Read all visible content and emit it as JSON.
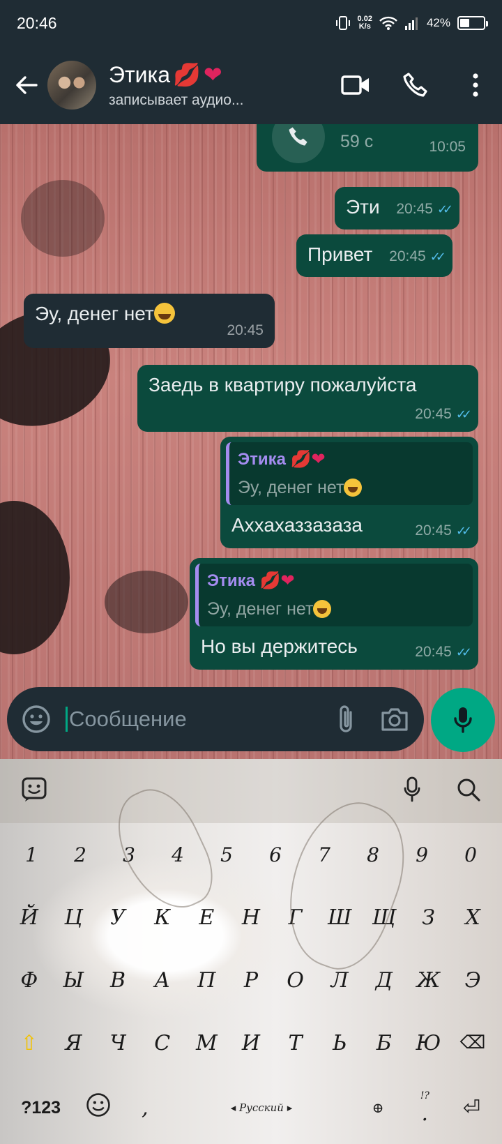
{
  "status_bar": {
    "time": "20:46",
    "net_speed_value": "0.02",
    "net_speed_unit": "K/s",
    "battery": "42%",
    "battery_level": 0.42
  },
  "header": {
    "contact_name": "Этика",
    "contact_status": "записывает аудио...",
    "icons": [
      "back-arrow-icon",
      "video-call-icon",
      "voice-call-icon",
      "more-icon"
    ]
  },
  "messages": [
    {
      "direction": "out",
      "type": "call",
      "duration": "59 с",
      "time": "10:05"
    },
    {
      "direction": "out",
      "text": "Эти",
      "time": "20:45",
      "status": "read"
    },
    {
      "direction": "out",
      "text": "Привет",
      "time": "20:45",
      "status": "read"
    },
    {
      "direction": "in",
      "text": "Эу, денег нет",
      "time": "20:45"
    },
    {
      "direction": "out",
      "text": "Заедь в квартиру пожалуйста",
      "time": "20:45",
      "status": "read"
    },
    {
      "direction": "out",
      "quote_name": "Этика",
      "quote_text": "Эу, денег нет",
      "text": "Аххахаззазаза",
      "time": "20:45",
      "status": "read"
    },
    {
      "direction": "out",
      "quote_name": "Этика",
      "quote_text": "Эу, денег нет",
      "text": "Но вы держитесь",
      "time": "20:45",
      "status": "read"
    }
  ],
  "composer": {
    "placeholder": "Сообщение"
  },
  "keyboard": {
    "row_numbers": [
      "1",
      "2",
      "3",
      "4",
      "5",
      "6",
      "7",
      "8",
      "9",
      "0"
    ],
    "row1": [
      "Й",
      "Ц",
      "У",
      "К",
      "Е",
      "Н",
      "Г",
      "Ш",
      "Щ",
      "З",
      "Х"
    ],
    "row2": [
      "Ф",
      "Ы",
      "В",
      "А",
      "П",
      "Р",
      "О",
      "Л",
      "Д",
      "Ж",
      "Э"
    ],
    "row3": [
      "Я",
      "Ч",
      "С",
      "М",
      "И",
      "Т",
      "Ь",
      "Б",
      "Ю"
    ],
    "symbols_key": "?123",
    "comma": ",",
    "space_label": "Русский",
    "period": ".",
    "punct_hint": "!?"
  },
  "colors": {
    "header_bg": "#1f2c34",
    "outgoing_bubble": "#0b4a3d",
    "incoming_bubble": "#1f2c34",
    "accent": "#00a884",
    "read_ticks": "#53bdeb",
    "quote_accent": "#a48cf0"
  }
}
